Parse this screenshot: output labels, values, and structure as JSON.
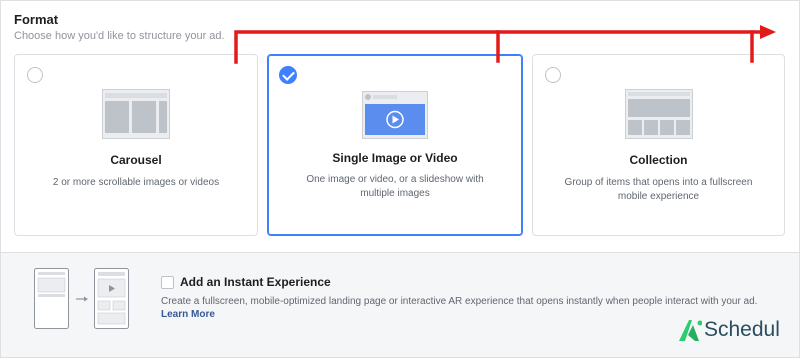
{
  "format": {
    "title": "Format",
    "subtitle": "Choose how you'd like to structure your ad."
  },
  "options": [
    {
      "title": "Carousel",
      "description": "2 or more scrollable images or videos",
      "selected": false
    },
    {
      "title": "Single Image or Video",
      "description": "One image or video, or a slideshow with multiple images",
      "selected": true
    },
    {
      "title": "Collection",
      "description": "Group of items that opens into a fullscreen mobile experience",
      "selected": false
    }
  ],
  "instant_experience": {
    "label": "Add an Instant Experience",
    "description": "Create a fullscreen, mobile-optimized landing page or interactive AR experience that opens instantly when people interact with your ad.",
    "link": "Learn More",
    "checked": false
  },
  "brand": {
    "text": "Schedul",
    "accent_color": "#2ecc71"
  },
  "colors": {
    "selected_border": "#4080ff",
    "annotation_arrow": "#e21a1a",
    "link": "#385898"
  }
}
